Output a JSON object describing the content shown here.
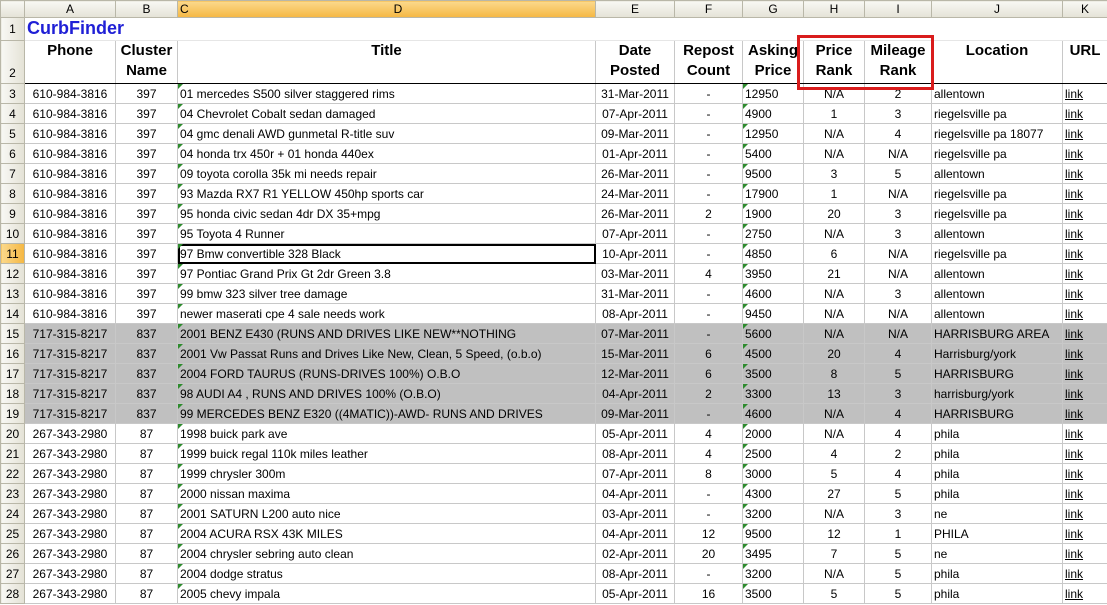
{
  "app_title": "CurbFinder",
  "column_letters": [
    "A",
    "B",
    "C",
    "D",
    "E",
    "F",
    "G",
    "H",
    "I",
    "J",
    "K"
  ],
  "selected_column": "C",
  "selected_row": "11",
  "headers": {
    "phone": "Phone",
    "cluster": "Cluster Name",
    "title": "Title",
    "date": "Date Posted",
    "repost": "Repost Count",
    "asking": "Asking Price",
    "price_rank": "Price Rank",
    "mileage_rank": "Mileage Rank",
    "location": "Location",
    "url": "URL"
  },
  "highlight_color": "#d91c1c",
  "rows": [
    {
      "n": "3",
      "phone": "610-984-3816",
      "cluster": "397",
      "title": "01 mercedes S500 silver staggered rims",
      "date": "31-Mar-2011",
      "repost": "-",
      "asking": "12950",
      "price_rank": "N/A",
      "mileage_rank": "2",
      "location": "allentown",
      "url": "link",
      "grey": false
    },
    {
      "n": "4",
      "phone": "610-984-3816",
      "cluster": "397",
      "title": "04 Chevrolet Cobalt sedan damaged",
      "date": "07-Apr-2011",
      "repost": "-",
      "asking": "4900",
      "price_rank": "1",
      "mileage_rank": "3",
      "location": "riegelsville pa",
      "url": "link",
      "grey": false
    },
    {
      "n": "5",
      "phone": "610-984-3816",
      "cluster": "397",
      "title": "04 gmc denali AWD gunmetal R-title suv",
      "date": "09-Mar-2011",
      "repost": "-",
      "asking": "12950",
      "price_rank": "N/A",
      "mileage_rank": "4",
      "location": "riegelsville pa 18077",
      "url": "link",
      "grey": false
    },
    {
      "n": "6",
      "phone": "610-984-3816",
      "cluster": "397",
      "title": "04 honda trx 450r + 01 honda 440ex",
      "date": "01-Apr-2011",
      "repost": "-",
      "asking": "5400",
      "price_rank": "N/A",
      "mileage_rank": "N/A",
      "location": "riegelsville pa",
      "url": "link",
      "grey": false
    },
    {
      "n": "7",
      "phone": "610-984-3816",
      "cluster": "397",
      "title": "09 toyota corolla 35k mi needs repair",
      "date": "26-Mar-2011",
      "repost": "-",
      "asking": "9500",
      "price_rank": "3",
      "mileage_rank": "5",
      "location": "allentown",
      "url": "link",
      "grey": false
    },
    {
      "n": "8",
      "phone": "610-984-3816",
      "cluster": "397",
      "title": "93 Mazda RX7 R1 YELLOW 450hp sports car",
      "date": "24-Mar-2011",
      "repost": "-",
      "asking": "17900",
      "price_rank": "1",
      "mileage_rank": "N/A",
      "location": "riegelsville pa",
      "url": "link",
      "grey": false
    },
    {
      "n": "9",
      "phone": "610-984-3816",
      "cluster": "397",
      "title": "95 honda civic sedan 4dr DX 35+mpg",
      "date": "26-Mar-2011",
      "repost": "2",
      "asking": "1900",
      "price_rank": "20",
      "mileage_rank": "3",
      "location": "riegelsville pa",
      "url": "link",
      "grey": false
    },
    {
      "n": "10",
      "phone": "610-984-3816",
      "cluster": "397",
      "title": "95 Toyota 4 Runner",
      "date": "07-Apr-2011",
      "repost": "-",
      "asking": "2750",
      "price_rank": "N/A",
      "mileage_rank": "3",
      "location": "allentown",
      "url": "link",
      "grey": false
    },
    {
      "n": "11",
      "phone": "610-984-3816",
      "cluster": "397",
      "title": "97 Bmw convertible 328 Black",
      "date": "10-Apr-2011",
      "repost": "-",
      "asking": "4850",
      "price_rank": "6",
      "mileage_rank": "N/A",
      "location": "riegelsville pa",
      "url": "link",
      "grey": false
    },
    {
      "n": "12",
      "phone": "610-984-3816",
      "cluster": "397",
      "title": "97 Pontiac Grand Prix Gt 2dr Green 3.8",
      "date": "03-Mar-2011",
      "repost": "4",
      "asking": "3950",
      "price_rank": "21",
      "mileage_rank": "N/A",
      "location": "allentown",
      "url": "link",
      "grey": false
    },
    {
      "n": "13",
      "phone": "610-984-3816",
      "cluster": "397",
      "title": "99 bmw 323 silver tree damage",
      "date": "31-Mar-2011",
      "repost": "-",
      "asking": "4600",
      "price_rank": "N/A",
      "mileage_rank": "3",
      "location": "allentown",
      "url": "link",
      "grey": false
    },
    {
      "n": "14",
      "phone": "610-984-3816",
      "cluster": "397",
      "title": "newer maserati cpe 4 sale needs work",
      "date": "08-Apr-2011",
      "repost": "-",
      "asking": "9450",
      "price_rank": "N/A",
      "mileage_rank": "N/A",
      "location": "allentown",
      "url": "link",
      "grey": false
    },
    {
      "n": "15",
      "phone": "717-315-8217",
      "cluster": "837",
      "title": "2001 BENZ E430 (RUNS AND DRIVES LIKE NEW**NOTHING",
      "date": "07-Mar-2011",
      "repost": "-",
      "asking": "5600",
      "price_rank": "N/A",
      "mileage_rank": "N/A",
      "location": "HARRISBURG AREA",
      "url": "link",
      "grey": true
    },
    {
      "n": "16",
      "phone": "717-315-8217",
      "cluster": "837",
      "title": "2001 Vw Passat Runs and Drives Like New, Clean, 5 Speed, (o.b.o)",
      "date": "15-Mar-2011",
      "repost": "6",
      "asking": "4500",
      "price_rank": "20",
      "mileage_rank": "4",
      "location": "Harrisburg/york",
      "url": "link",
      "grey": true
    },
    {
      "n": "17",
      "phone": "717-315-8217",
      "cluster": "837",
      "title": "2004 FORD TAURUS (RUNS-DRIVES 100%) O.B.O",
      "date": "12-Mar-2011",
      "repost": "6",
      "asking": "3500",
      "price_rank": "8",
      "mileage_rank": "5",
      "location": "HARRISBURG",
      "url": "link",
      "grey": true
    },
    {
      "n": "18",
      "phone": "717-315-8217",
      "cluster": "837",
      "title": "98 AUDI A4 , RUNS AND DRIVES 100% (O.B.O)",
      "date": "04-Apr-2011",
      "repost": "2",
      "asking": "3300",
      "price_rank": "13",
      "mileage_rank": "3",
      "location": "harrisburg/york",
      "url": "link",
      "grey": true
    },
    {
      "n": "19",
      "phone": "717-315-8217",
      "cluster": "837",
      "title": "99 MERCEDES BENZ E320 ((4MATIC))-AWD- RUNS AND DRIVES",
      "date": "09-Mar-2011",
      "repost": "-",
      "asking": "4600",
      "price_rank": "N/A",
      "mileage_rank": "4",
      "location": "HARRISBURG",
      "url": "link",
      "grey": true
    },
    {
      "n": "20",
      "phone": "267-343-2980",
      "cluster": "87",
      "title": "1998 buick park ave",
      "date": "05-Apr-2011",
      "repost": "4",
      "asking": "2000",
      "price_rank": "N/A",
      "mileage_rank": "4",
      "location": "phila",
      "url": "link",
      "grey": false
    },
    {
      "n": "21",
      "phone": "267-343-2980",
      "cluster": "87",
      "title": "1999 buick regal 110k miles leather",
      "date": "08-Apr-2011",
      "repost": "4",
      "asking": "2500",
      "price_rank": "4",
      "mileage_rank": "2",
      "location": "phila",
      "url": "link",
      "grey": false
    },
    {
      "n": "22",
      "phone": "267-343-2980",
      "cluster": "87",
      "title": "1999 chrysler 300m",
      "date": "07-Apr-2011",
      "repost": "8",
      "asking": "3000",
      "price_rank": "5",
      "mileage_rank": "4",
      "location": "phila",
      "url": "link",
      "grey": false
    },
    {
      "n": "23",
      "phone": "267-343-2980",
      "cluster": "87",
      "title": "2000 nissan maxima",
      "date": "04-Apr-2011",
      "repost": "-",
      "asking": "4300",
      "price_rank": "27",
      "mileage_rank": "5",
      "location": "phila",
      "url": "link",
      "grey": false
    },
    {
      "n": "24",
      "phone": "267-343-2980",
      "cluster": "87",
      "title": "2001 SATURN L200 auto nice",
      "date": "03-Apr-2011",
      "repost": "-",
      "asking": "3200",
      "price_rank": "N/A",
      "mileage_rank": "3",
      "location": "ne",
      "url": "link",
      "grey": false
    },
    {
      "n": "25",
      "phone": "267-343-2980",
      "cluster": "87",
      "title": "2004 ACURA RSX 43K MILES",
      "date": "04-Apr-2011",
      "repost": "12",
      "asking": "9500",
      "price_rank": "12",
      "mileage_rank": "1",
      "location": "PHILA",
      "url": "link",
      "grey": false
    },
    {
      "n": "26",
      "phone": "267-343-2980",
      "cluster": "87",
      "title": "2004 chrysler sebring auto clean",
      "date": "02-Apr-2011",
      "repost": "20",
      "asking": "3495",
      "price_rank": "7",
      "mileage_rank": "5",
      "location": "ne",
      "url": "link",
      "grey": false
    },
    {
      "n": "27",
      "phone": "267-343-2980",
      "cluster": "87",
      "title": "2004 dodge stratus",
      "date": "08-Apr-2011",
      "repost": "-",
      "asking": "3200",
      "price_rank": "N/A",
      "mileage_rank": "5",
      "location": "phila",
      "url": "link",
      "grey": false
    },
    {
      "n": "28",
      "phone": "267-343-2980",
      "cluster": "87",
      "title": "2005 chevy impala",
      "date": "05-Apr-2011",
      "repost": "16",
      "asking": "3500",
      "price_rank": "5",
      "mileage_rank": "5",
      "location": "phila",
      "url": "link",
      "grey": false
    }
  ]
}
